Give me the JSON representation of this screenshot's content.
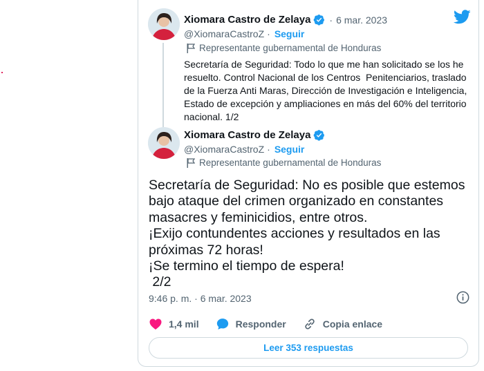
{
  "colors": {
    "accent": "#1d9bf0",
    "like": "#f91880",
    "secondary_text": "#536471",
    "border": "#cfd9de"
  },
  "icons": {
    "brand": "twitter-bird-icon",
    "verified": "verified-badge-icon",
    "label": "flag-icon",
    "info": "info-icon",
    "like": "heart-icon",
    "reply": "speech-bubble-icon",
    "copy": "link-icon"
  },
  "tweet1": {
    "author": "Xiomara Castro de Zelaya",
    "date": "6 mar. 2023",
    "handle": "@XiomaraCastroZ",
    "follow": "Seguir",
    "label": "Representante gubernamental de Honduras",
    "text": "Secretaría de Seguridad: Todo lo que me han solicitado se los he\nresuelto. Control Nacional de los Centros  Penitenciarios, traslado\nde la Fuerza Anti Maras, Dirección de Investigación e Inteligencia,\nEstado de excepción y ampliaciones en más del 60% del territorio\nnacional. 1/2"
  },
  "tweet2": {
    "author": "Xiomara Castro de Zelaya",
    "handle": "@XiomaraCastroZ",
    "follow": "Seguir",
    "label": "Representante gubernamental de Honduras",
    "text": "Secretaría de Seguridad: No es posible que estemos\nbajo ataque del crimen organizado en constantes\nmasacres y feminicidios, entre otros.\n¡Exijo contundentes acciones y resultados en las\npróximas 72 horas!\n¡Se termino el tiempo de espera!\n 2/2",
    "timestamp": "9:46 p. m. · 6 mar. 2023"
  },
  "actions": {
    "likes": "1,4 mil",
    "reply": "Responder",
    "copy_link": "Copia enlace",
    "read_replies": "Leer 353 respuestas"
  }
}
